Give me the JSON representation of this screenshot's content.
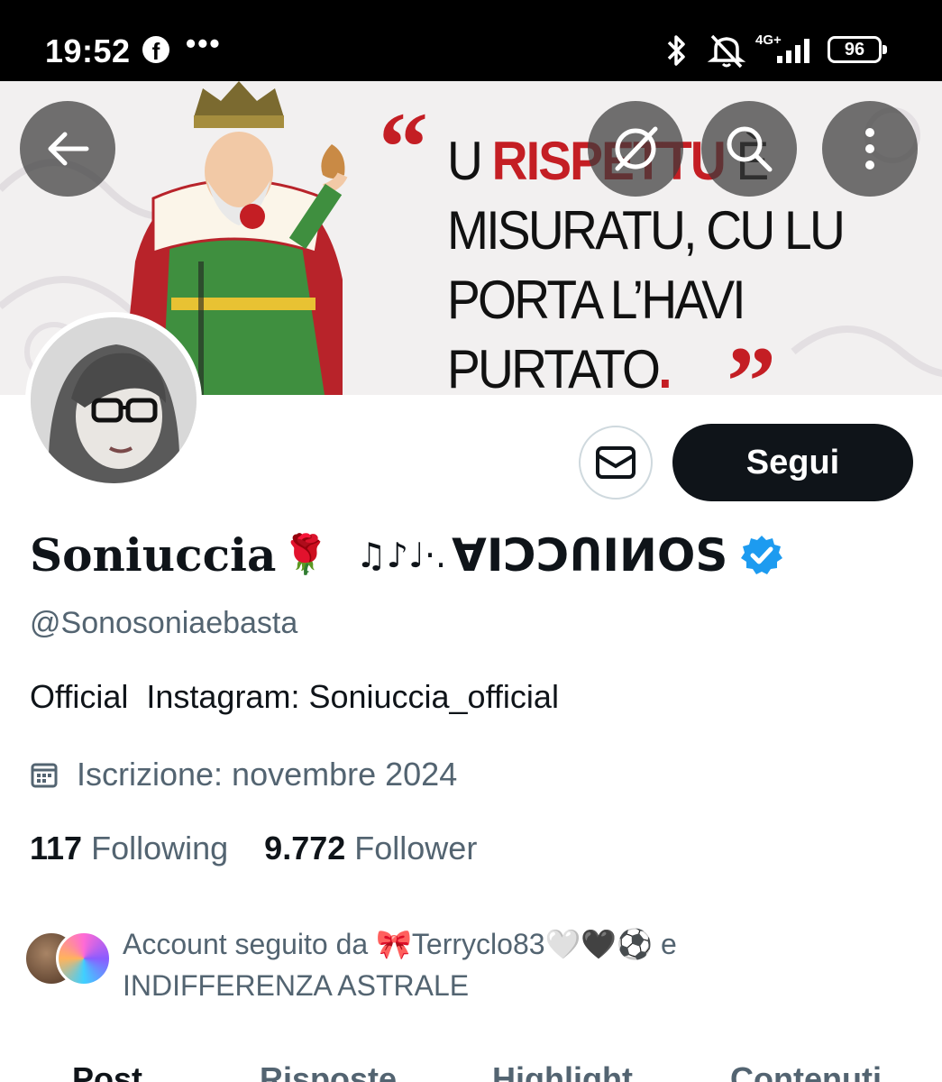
{
  "status_bar": {
    "time": "19:52",
    "facebook_glyph": "f",
    "more_dots": "•••",
    "network": "4G+",
    "battery": "96"
  },
  "banner": {
    "quote_lines": [
      {
        "black": "U ",
        "red": "RISPETTU",
        "rest": " È"
      },
      {
        "black": "MISURATU, CU LU",
        "red": "",
        "rest": ""
      },
      {
        "black": "PORTA L’HAVI",
        "red": "",
        "rest": ""
      },
      {
        "black": "PURTATO",
        "red": ".",
        "rest": ""
      }
    ],
    "open_quote": "“",
    "close_quote": "”"
  },
  "profile": {
    "name_fancy": "Soniuccia",
    "name_rose": "🌹",
    "name_notes": "♫♪♩·.",
    "name_flipped": "ꓯIƆƆՈIИOS",
    "handle": "@Sonosoniaebasta",
    "bio": "Official  Instagram: Soniuccia_official",
    "joined": "Iscrizione: novembre 2024",
    "following_count": "117",
    "following_label": "Following",
    "followers_count": "9.772",
    "followers_label": "Follower",
    "followed_by_line1": "Account seguito da 🎀Terryclo83🤍🖤⚽ e",
    "followed_by_line2": "INDIFFERENZA ASTRALE"
  },
  "actions": {
    "follow_label": "Segui"
  },
  "tabs": [
    {
      "label": "Post"
    },
    {
      "label": "Risposte"
    },
    {
      "label": "Highlight"
    },
    {
      "label": "Contenuti"
    }
  ],
  "colors": {
    "accent_red": "#c41e24",
    "verified_blue": "#1d9bf0",
    "text_primary": "#0f1419",
    "text_secondary": "#536471"
  },
  "icons": [
    "back-arrow-icon",
    "grok-icon",
    "search-icon",
    "more-vertical-icon",
    "mail-icon",
    "verified-badge-icon",
    "calendar-icon",
    "bluetooth-icon",
    "muted-bell-icon",
    "signal-icon"
  ]
}
